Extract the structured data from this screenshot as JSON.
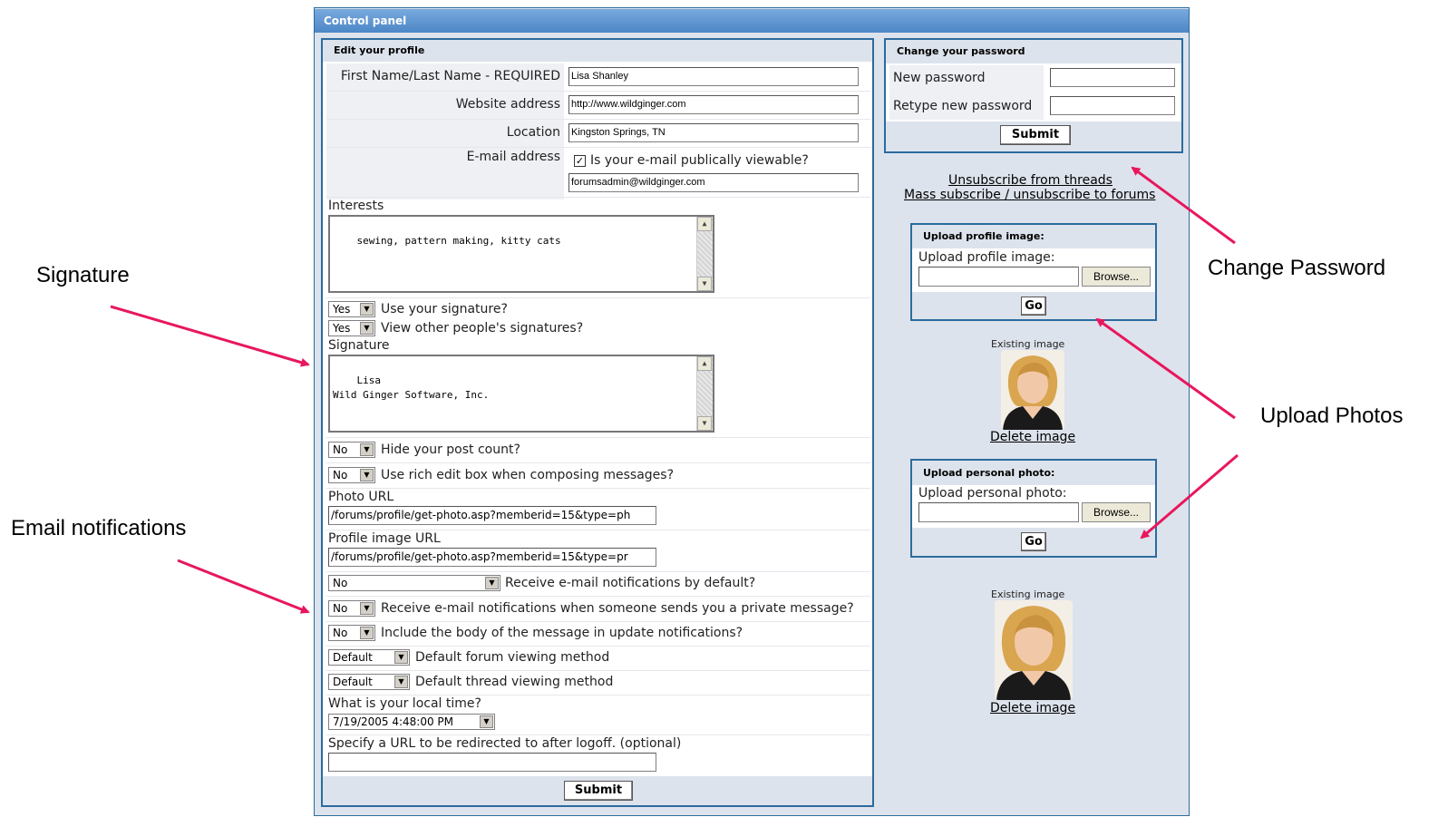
{
  "panel": {
    "title": "Control panel"
  },
  "profile": {
    "header": "Edit your profile",
    "name_label": "First Name/Last Name - REQUIRED",
    "name_value": "Lisa Shanley",
    "website_label": "Website address",
    "website_value": "http://www.wildginger.com",
    "location_label": "Location",
    "location_value": "Kingston Springs, TN",
    "email_label": "E-mail address",
    "email_public_label": "Is your e-mail publically viewable?",
    "email_public_checked": true,
    "email_value": "forumsadmin@wildginger.com",
    "interests_label": "Interests",
    "interests_value": "sewing, pattern making, kitty cats",
    "use_sig_value": "Yes",
    "use_sig_label": "Use your signature?",
    "view_sig_value": "Yes",
    "view_sig_label": "View other people's signatures?",
    "signature_label": "Signature",
    "signature_value": "Lisa\nWild Ginger Software, Inc.",
    "hide_post_value": "No",
    "hide_post_label": "Hide your post count?",
    "rich_edit_value": "No",
    "rich_edit_label": "Use rich edit box when composing messages?",
    "photo_url_label": "Photo URL",
    "photo_url_value": "/forums/profile/get-photo.asp?memberid=15&type=ph",
    "profile_url_label": "Profile image URL",
    "profile_url_value": "/forums/profile/get-photo.asp?memberid=15&type=pr",
    "notify_default_value": "No",
    "notify_default_label": "Receive e-mail notifications by default?",
    "notify_pm_value": "No",
    "notify_pm_label": "Receive e-mail notifications when someone sends you a private message?",
    "include_body_value": "No",
    "include_body_label": "Include the body of the message in update notifications?",
    "forum_view_value": "Default",
    "forum_view_label": "Default forum viewing method",
    "thread_view_value": "Default",
    "thread_view_label": "Default thread viewing method",
    "local_time_label": "What is your local time?",
    "local_time_value": "7/19/2005 4:48:00 PM",
    "redirect_label": "Specify a URL to be redirected to after logoff. (optional)",
    "redirect_value": "",
    "submit_label": "Submit"
  },
  "password": {
    "header": "Change your password",
    "new_label": "New password",
    "retype_label": "Retype new password",
    "submit_label": "Submit"
  },
  "links": {
    "unsubscribe": "Unsubscribe from threads",
    "mass_subscribe": "Mass subscribe / unsubscribe to forums"
  },
  "upload_profile": {
    "header": "Upload profile image:",
    "label": "Upload profile image:",
    "browse_label": "Browse...",
    "go_label": "Go",
    "existing_caption": "Existing image",
    "delete_label": "Delete image"
  },
  "upload_personal": {
    "header": "Upload personal photo:",
    "label": "Upload personal photo:",
    "browse_label": "Browse...",
    "go_label": "Go",
    "existing_caption": "Existing image",
    "delete_label": "Delete image"
  },
  "annotations": {
    "signature": "Signature",
    "email_notifications": "Email notifications",
    "change_password": "Change Password",
    "upload_photos": "Upload Photos"
  },
  "icons": {
    "dropdown": "chevron-down-icon",
    "scroll_up": "scroll-up-icon",
    "scroll_down": "scroll-down-icon",
    "checkbox": "checkmark-icon"
  },
  "colors": {
    "panel_border": "#2c6b9e",
    "title_bar": "#5b93cf",
    "panel_bg": "#dde3ec",
    "annotation_arrow": "#e8175d"
  }
}
